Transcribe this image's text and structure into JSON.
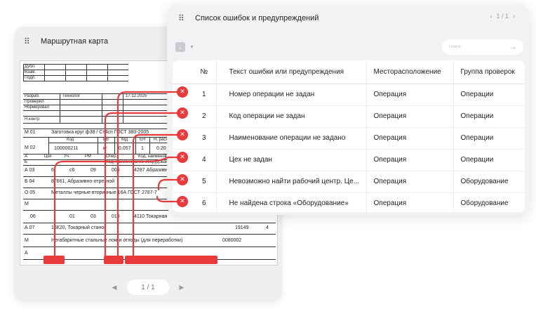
{
  "route_panel": {
    "title": "Маршрутная карта",
    "pager": {
      "current": "1 / 1",
      "prev_icon": "chevron-left-icon",
      "next_icon": "chevron-right-icon"
    },
    "doc": {
      "rows_top": [
        "Дубл.",
        "Взам.",
        "Подп."
      ],
      "signers": [
        "Разраб.",
        "Проверил",
        "Нормировал",
        "",
        "Н.контр"
      ],
      "role": "Технолог",
      "date": "17.12.2025",
      "m01": "М  01",
      "m01_text": "Заготовка круг ф38 / Ст4сп ГОСТ 380-2005",
      "m02": "М  02",
      "m02_heads": [
        "Код",
        "ЕВ",
        "МД",
        "ЕН",
        "Н. расх"
      ],
      "m02_vals": [
        "100000211",
        "кг",
        "0.057",
        "1",
        "0.20"
      ],
      "ab_heads": [
        "А",
        "Цех",
        "Уч.",
        "РМ",
        "Опер.",
        "Код, наименование операции"
      ],
      "b_head": [
        "Б",
        "Код, наименование оборудования"
      ],
      "a03": "А  03",
      "a03_vals": [
        "6",
        "с6",
        "09",
        "005",
        "4287 Абразивн"
      ],
      "b04": "Б  04",
      "b04_text": "8Г661, Абразивно-отрезной",
      "o05": "О  05",
      "o05_text": "Металлы черные вторичные 16А ГОСТ 2787-7",
      "m_empty": "М",
      "r06": "06",
      "r06_vals": [
        "01",
        "03",
        "010",
        "4110 Токарная"
      ],
      "a07": "А  07",
      "a07_text": "16К20, Токарный станок",
      "a07_vals": [
        "19149",
        "4"
      ],
      "m_last": "М",
      "m_last_text": "Негабаритные стальные лом и отходы (для переработки)",
      "m_last_code": "0080002",
      "a_last": "А"
    }
  },
  "errors_panel": {
    "title": "Список ошибок и предупреждений",
    "pager": "1 / 1",
    "export_icon": "download-icon",
    "search": {
      "placeholder": "Поиск",
      "icon": "arrow-right-icon"
    },
    "columns": [
      "№",
      "Текст ошибки или предупреждения",
      "Месторасположение",
      "Группа проверок"
    ],
    "rows": [
      {
        "num": "1",
        "text": "Номер операции не задан",
        "location": "Операция",
        "group": "Операции"
      },
      {
        "num": "2",
        "text": "Код операции не задан",
        "location": "Операция",
        "group": "Операции"
      },
      {
        "num": "3",
        "text": "Наименование операции не задано",
        "location": "Операция",
        "group": "Операции"
      },
      {
        "num": "4",
        "text": "Цех не задан",
        "location": "Операция",
        "group": "Операции"
      },
      {
        "num": "5",
        "text": "Невозможно найти рабочий центр. Це...",
        "location": "Операция",
        "group": "Оборудование"
      },
      {
        "num": "6",
        "text": "Не найдена строка «Оборудование»",
        "location": "Операция",
        "group": "Оборудование"
      }
    ],
    "badge_glyph": "✕",
    "colors": {
      "error_red": "#e83a3a",
      "panel_bg": "#f2f2f4"
    }
  }
}
